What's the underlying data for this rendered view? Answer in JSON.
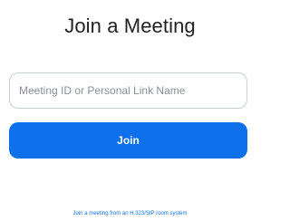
{
  "page": {
    "title": "Join a Meeting"
  },
  "form": {
    "meeting_id_placeholder": "Meeting ID or Personal Link Name",
    "meeting_id_value": "",
    "join_label": "Join"
  },
  "footer": {
    "h323_link_text": "Join a meeting from an H.323/SIP room system"
  },
  "colors": {
    "accent": "#0e71eb",
    "title_text": "#222222",
    "input_border": "#c9ced6",
    "link": "#0e71eb"
  }
}
